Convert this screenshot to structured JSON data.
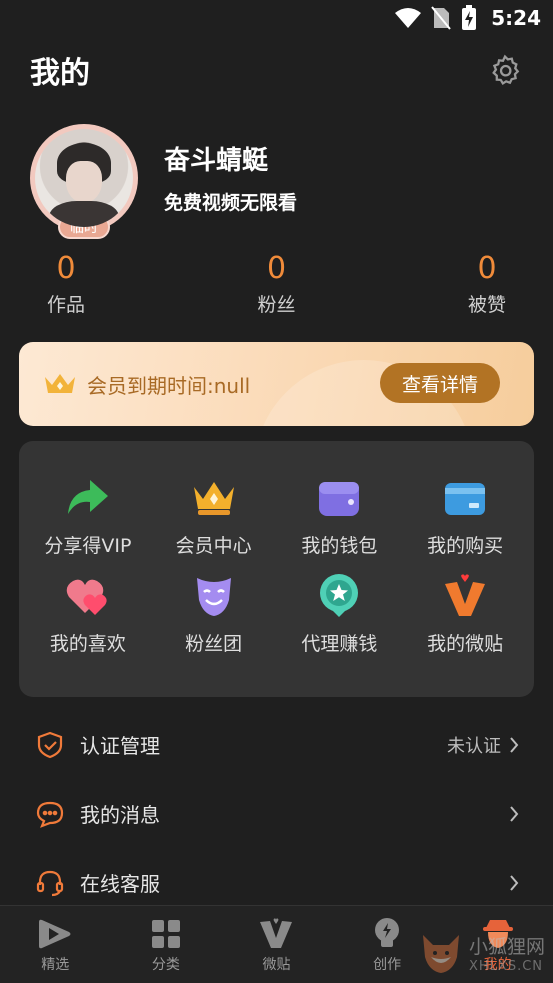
{
  "status_bar": {
    "time": "5:24",
    "icons": [
      "wifi-icon",
      "no-sim-icon",
      "battery-charging-icon"
    ]
  },
  "header": {
    "title": "我的",
    "settings_icon": "gear-icon"
  },
  "profile": {
    "username": "奋斗蜻蜓",
    "subtitle": "免费视频无限看",
    "badge": "临时"
  },
  "stats": [
    {
      "value": "0",
      "label": "作品"
    },
    {
      "value": "0",
      "label": "粉丝"
    },
    {
      "value": "0",
      "label": "被赞"
    }
  ],
  "vip_banner": {
    "text": "会员到期时间:null",
    "button": "查看详情"
  },
  "features": [
    {
      "label": "分享得VIP",
      "icon": "share-arrow-icon"
    },
    {
      "label": "会员中心",
      "icon": "crown-icon"
    },
    {
      "label": "我的钱包",
      "icon": "wallet-icon"
    },
    {
      "label": "我的购买",
      "icon": "card-icon"
    },
    {
      "label": "我的喜欢",
      "icon": "hearts-icon"
    },
    {
      "label": "粉丝团",
      "icon": "fan-mask-icon"
    },
    {
      "label": "代理赚钱",
      "icon": "star-medal-icon"
    },
    {
      "label": "我的微贴",
      "icon": "v-post-icon"
    }
  ],
  "menu": [
    {
      "label": "认证管理",
      "value": "未认证",
      "icon": "shield-check-icon"
    },
    {
      "label": "我的消息",
      "value": "",
      "icon": "chat-bubble-icon"
    },
    {
      "label": "在线客服",
      "value": "",
      "icon": "headset-icon"
    }
  ],
  "tabs": [
    {
      "label": "精选",
      "icon": "play-icon"
    },
    {
      "label": "分类",
      "icon": "grid-icon"
    },
    {
      "label": "微贴",
      "icon": "v-icon"
    },
    {
      "label": "创作",
      "icon": "bulb-icon"
    },
    {
      "label": "我的",
      "icon": "profile-icon",
      "active": true
    }
  ],
  "watermark": {
    "cn": "小狐狸网",
    "en": "XHLXS.CN"
  },
  "colors": {
    "accent": "#f08b3a",
    "active_tab": "#e6633a",
    "vip_button": "#b27324"
  }
}
